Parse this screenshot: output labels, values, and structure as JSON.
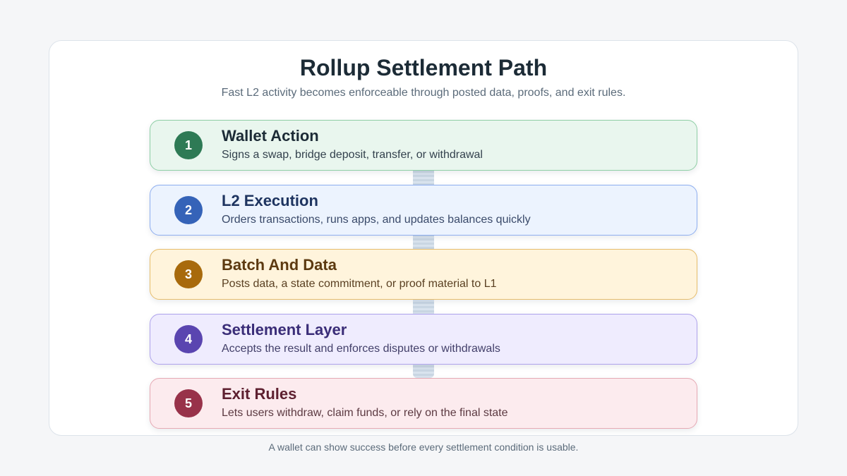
{
  "title": "Rollup Settlement Path",
  "subtitle": "Fast L2 activity becomes enforceable through posted data, proofs, and exit rules.",
  "footnote": "A wallet can show success before every settlement condition is usable.",
  "steps": [
    {
      "number": "1",
      "title": "Wallet Action",
      "description": "Signs a swap, bridge deposit, transfer, or withdrawal",
      "colors": {
        "bg": "#e9f6ee",
        "border": "#8fcfa6",
        "badge": "#2e7a55",
        "title": "#1c2b36",
        "text": "#33414d"
      }
    },
    {
      "number": "2",
      "title": "L2 Execution",
      "description": "Orders transactions, runs apps, and updates balances quickly",
      "colors": {
        "bg": "#ecf3fe",
        "border": "#8eaef0",
        "badge": "#3563b8",
        "title": "#1e3460",
        "text": "#3a4a6a"
      }
    },
    {
      "number": "3",
      "title": "Batch And Data",
      "description": "Posts data, a state commitment, or proof material to L1",
      "colors": {
        "bg": "#fff4dc",
        "border": "#e7bd6c",
        "badge": "#a86a0c",
        "title": "#5c3a10",
        "text": "#5a4022"
      }
    },
    {
      "number": "4",
      "title": "Settlement Layer",
      "description": "Accepts the result and enforces disputes or withdrawals",
      "colors": {
        "bg": "#efecfe",
        "border": "#aea2ec",
        "badge": "#5a45b0",
        "title": "#3a2d78",
        "text": "#43406a"
      }
    },
    {
      "number": "5",
      "title": "Exit Rules",
      "description": "Lets users withdraw, claim funds, or rely on the final state",
      "colors": {
        "bg": "#fcebee",
        "border": "#e6a9b4",
        "badge": "#98324a",
        "title": "#5e2030",
        "text": "#5c3a42"
      }
    }
  ]
}
